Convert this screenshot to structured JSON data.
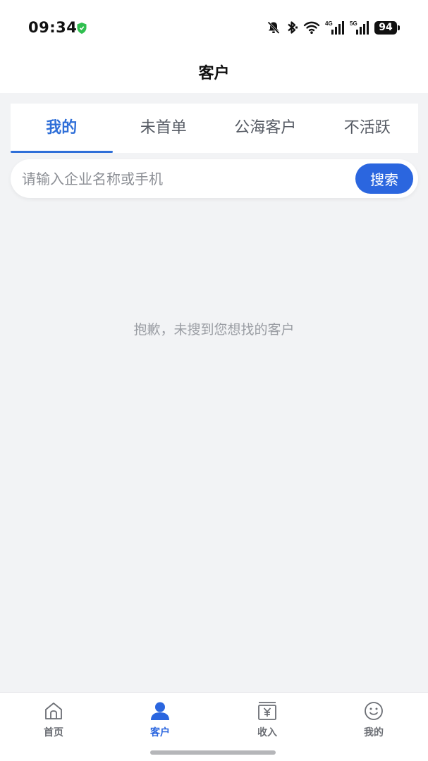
{
  "status_bar": {
    "time": "09:34",
    "battery": "94",
    "signal_4g": "4G",
    "signal_5g": "5G",
    "icons": [
      "shield-icon",
      "bell-off-icon",
      "bluetooth-icon",
      "wifi-icon",
      "signal-4g-icon",
      "signal-5g-icon",
      "battery-icon"
    ]
  },
  "header": {
    "title": "客户"
  },
  "tabs": [
    {
      "label": "我的"
    },
    {
      "label": "未首单"
    },
    {
      "label": "公海客户"
    },
    {
      "label": "不活跃"
    }
  ],
  "search": {
    "placeholder": "请输入企业名称或手机",
    "value": "",
    "button_label": "搜索"
  },
  "empty_state": {
    "message": "抱歉，未搜到您想找的客户"
  },
  "bottom_nav": [
    {
      "label": "首页",
      "icon": "home-icon"
    },
    {
      "label": "客户",
      "icon": "user-icon"
    },
    {
      "label": "收入",
      "icon": "yuan-icon"
    },
    {
      "label": "我的",
      "icon": "smile-icon"
    }
  ],
  "colors": {
    "accent": "#2b66df",
    "tab_active": "#2f6fd8",
    "background": "#f2f3f5",
    "inactive_text": "#6b6e74"
  }
}
